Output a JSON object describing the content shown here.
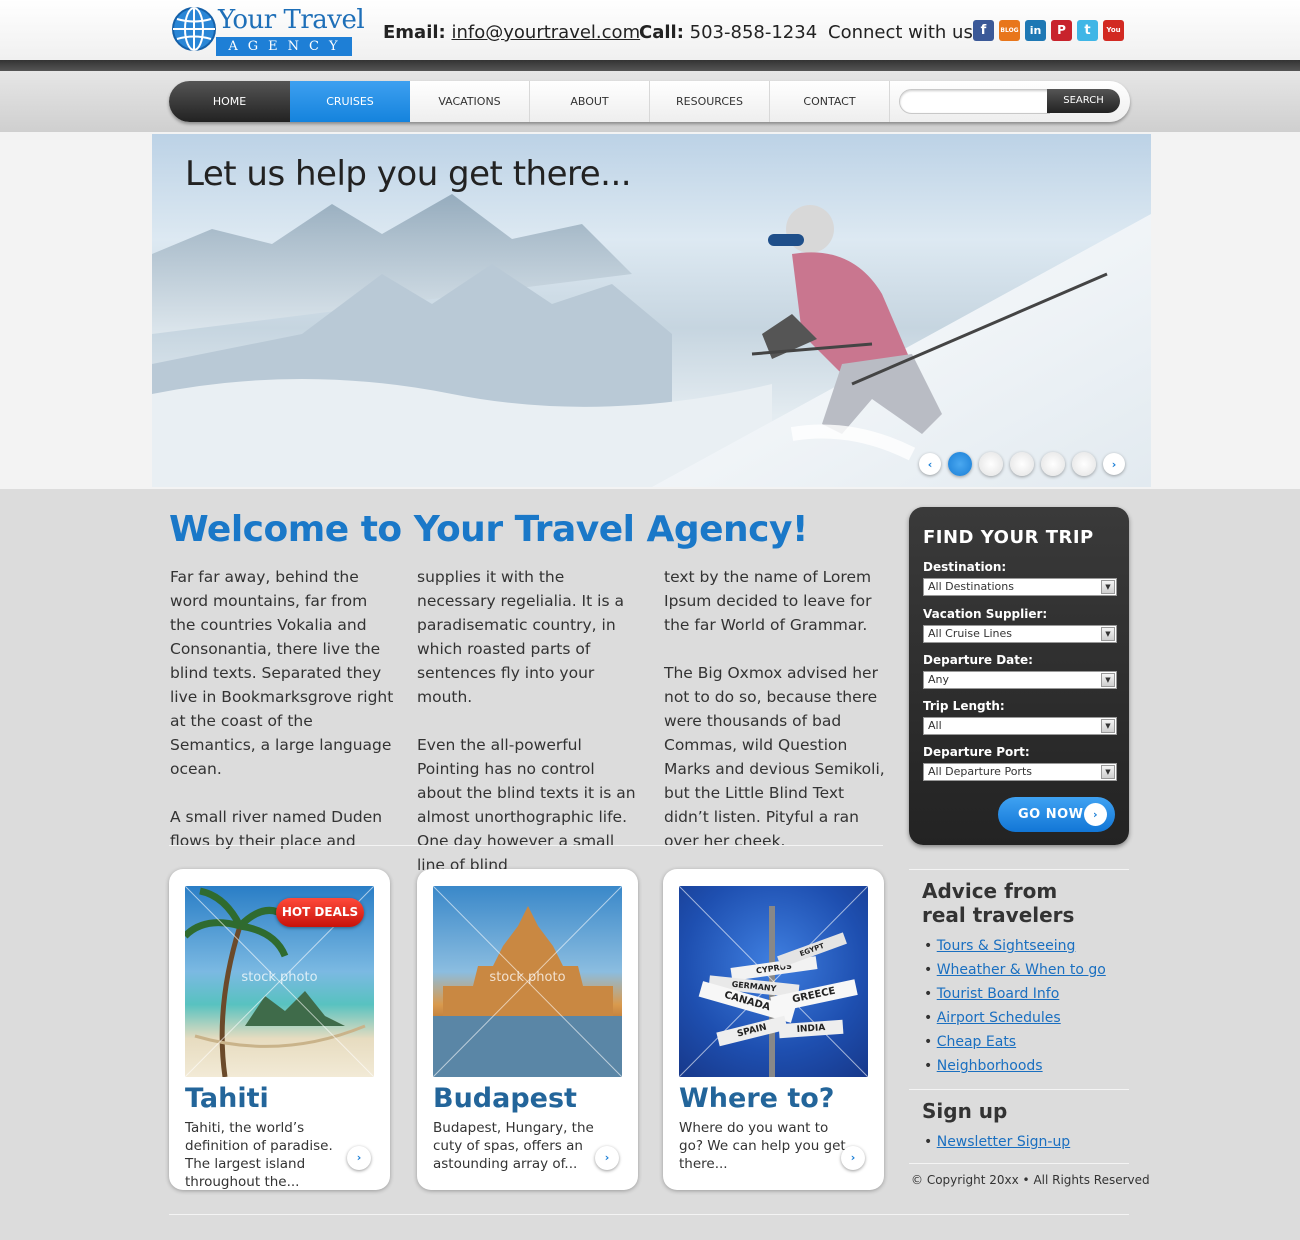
{
  "header": {
    "logo_top": "Your Travel",
    "logo_bottom": "AGENCY",
    "email_label": "Email:",
    "email_value": "info@yourtravel.com",
    "call_label": "Call:",
    "call_value": "503-858-1234",
    "connect_label": "Connect with us:",
    "social": [
      {
        "icon": "facebook-icon",
        "glyph": "f",
        "color": "#3b5998"
      },
      {
        "icon": "blog-icon",
        "glyph": "BLOG",
        "color": "#e8761b"
      },
      {
        "icon": "linkedin-icon",
        "glyph": "in",
        "color": "#1e78b4"
      },
      {
        "icon": "pinterest-icon",
        "glyph": "P",
        "color": "#c8232c"
      },
      {
        "icon": "twitter-icon",
        "glyph": "t",
        "color": "#3fb6e6"
      },
      {
        "icon": "youtube-icon",
        "glyph": "You",
        "color": "#d22a22"
      }
    ]
  },
  "nav": {
    "items": [
      "HOME",
      "CRUISES",
      "VACATIONS",
      "ABOUT",
      "RESOURCES",
      "CONTACT"
    ],
    "search_placeholder": "",
    "search_button": "SEARCH"
  },
  "hero": {
    "title": "Let us help you get there...",
    "slide_count": 6,
    "active_slide": 1
  },
  "welcome": {
    "title": "Welcome to Your Travel Agency!",
    "col1": [
      "Far far away, behind the word mountains, far from the countries Vokalia and Consonantia, there live the blind texts. Separated they live in Bookmarksgrove right at the coast of the Semantics, a large language ocean.",
      "A small river named Duden flows by their place and"
    ],
    "col2": [
      "supplies it with the necessary regelialia. It is a paradisematic country, in which roasted parts of sentences fly into your mouth.",
      "Even the all-powerful Pointing has no control about the blind texts it is an almost unorthographic life. One day however a small line of blind"
    ],
    "col3": [
      "text by the name of Lorem Ipsum decided to leave for the far World of Grammar.",
      "The Big Oxmox advised her not to do so, because there were thousands of bad Commas, wild Question Marks and devious Semikoli, but the Little Blind Text didn’t listen. Pityful a ran over her cheek."
    ]
  },
  "cards": [
    {
      "title": "Tahiti",
      "text": "Tahiti, the world’s definition of paradise. The largest island throughout the...",
      "badge": "HOT DEALS",
      "watermark": "stock photo"
    },
    {
      "title": "Budapest",
      "text": "Budapest, Hungary, the cuty of spas, offers an astounding array of...",
      "watermark": "stock photo"
    },
    {
      "title": "Where to?",
      "text": "Where do you want to go? We can help you get there..."
    }
  ],
  "signpost": [
    "CYPRUS",
    "GERMANY",
    "CANADA",
    "GREECE",
    "SPAIN",
    "INDIA",
    "EGYPT"
  ],
  "trip": {
    "title": "FIND YOUR TRIP",
    "fields": [
      {
        "label": "Destination:",
        "value": "All Destinations"
      },
      {
        "label": "Vacation Supplier:",
        "value": "All Cruise Lines"
      },
      {
        "label": "Departure Date:",
        "value": "Any"
      },
      {
        "label": "Trip Length:",
        "value": "All"
      },
      {
        "label": "Departure Port:",
        "value": "All Departure Ports"
      }
    ],
    "button": "GO NOW"
  },
  "sidebar": {
    "advice_title": [
      "Advice from",
      "real travelers"
    ],
    "advice_links": [
      "Tours & Sightseeing",
      "Wheather & When to go",
      "Tourist Board Info",
      "Airport Schedules",
      "Cheap Eats",
      "Neighborhoods"
    ],
    "signup_title": "Sign up",
    "signup_links": [
      "Newsletter Sign-up"
    ],
    "copyright": "© Copyright 20xx • All Rights Reserved"
  }
}
